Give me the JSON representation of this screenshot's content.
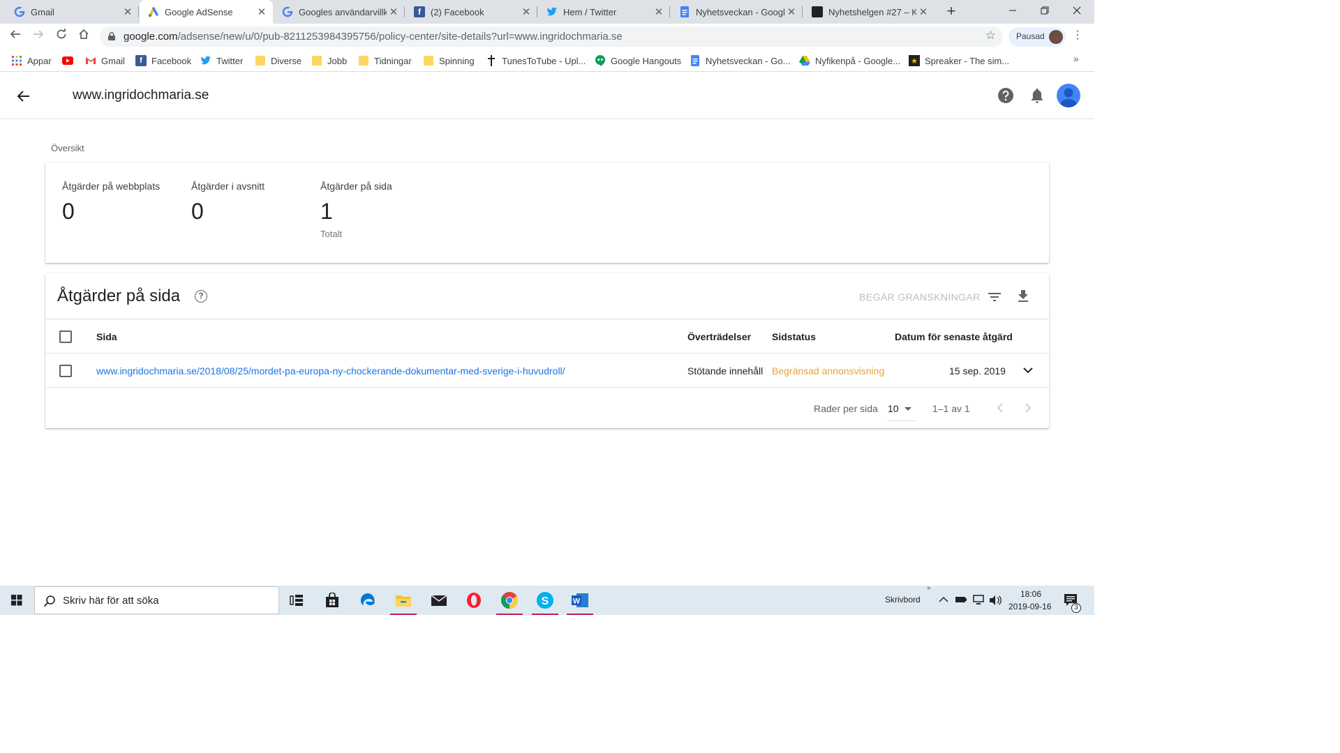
{
  "browser": {
    "tabs": [
      {
        "title": "Gmail",
        "favicon": "google-g-icon",
        "active": false
      },
      {
        "title": "Google AdSense",
        "favicon": "adsense-icon",
        "active": true
      },
      {
        "title": "Googles användarvillko",
        "favicon": "google-g-icon",
        "active": false
      },
      {
        "title": "(2) Facebook",
        "favicon": "facebook-icon",
        "active": false
      },
      {
        "title": "Hem / Twitter",
        "favicon": "twitter-icon",
        "active": false
      },
      {
        "title": "Nyhetsveckan - Googl",
        "favicon": "docs-icon",
        "active": false
      },
      {
        "title": "Nyhetshelgen #27 – Kl",
        "favicon": "terminal-icon",
        "active": false
      }
    ],
    "url_host": "google.com",
    "url_path": "/adsense/new/u/0/pub-8211253984395756/policy-center/site-details?url=www.ingridochmaria.se",
    "profile_label": "Pausad",
    "bookmarks": [
      {
        "label": "Appar",
        "icon": "apps-grid-icon"
      },
      {
        "label": "",
        "icon": "youtube-icon"
      },
      {
        "label": "Gmail",
        "icon": "gmail-icon"
      },
      {
        "label": "Facebook",
        "icon": "facebook-icon"
      },
      {
        "label": "Twitter",
        "icon": "twitter-icon"
      },
      {
        "label": "Diverse",
        "icon": "folder-icon"
      },
      {
        "label": "Jobb",
        "icon": "folder-icon"
      },
      {
        "label": "Tidningar",
        "icon": "folder-icon"
      },
      {
        "label": "Spinning",
        "icon": "folder-icon"
      },
      {
        "label": "TunesToTube - Upl...",
        "icon": "cross-icon"
      },
      {
        "label": "Google Hangouts",
        "icon": "hangouts-icon"
      },
      {
        "label": "Nyhetsveckan - Go...",
        "icon": "docs-icon"
      },
      {
        "label": "Nyfikenpå - Google...",
        "icon": "drive-icon"
      },
      {
        "label": "Spreaker - The sim...",
        "icon": "spreaker-icon"
      }
    ]
  },
  "header": {
    "site_title": "www.ingridochmaria.se"
  },
  "overview": {
    "section_label": "Översikt",
    "stats": [
      {
        "label": "Åtgärder på webbplats",
        "value": "0",
        "sub": ""
      },
      {
        "label": "Åtgärder i avsnitt",
        "value": "0",
        "sub": ""
      },
      {
        "label": "Åtgärder på sida",
        "value": "1",
        "sub": "Totalt"
      }
    ]
  },
  "table": {
    "title": "Åtgärder på sida",
    "request_review_label": "BEGÄR GRANSKNINGAR",
    "columns": {
      "page": "Sida",
      "violations": "Överträdelser",
      "status": "Sidstatus",
      "date": "Datum för senaste åtgärd"
    },
    "rows": [
      {
        "page": "www.ingridochmaria.se/2018/08/25/mordet-pa-europa-ny-chockerande-dokumentar-med-sverige-i-huvudroll/",
        "violations": "Stötande innehåll",
        "status": "Begränsad annonsvisning",
        "date": "15 sep. 2019"
      }
    ],
    "pagination": {
      "rows_per_page_label": "Rader per sida",
      "rows_per_page": "10",
      "range": "1–1 av 1"
    }
  },
  "taskbar": {
    "search_placeholder": "Skriv här för att söka",
    "desktop_label": "Skrivbord",
    "time": "18:06",
    "date": "2019-09-16",
    "notification_count": "3"
  },
  "colors": {
    "link": "#1a73e8",
    "warning": "#e8a534",
    "accent": "#4285f4"
  }
}
